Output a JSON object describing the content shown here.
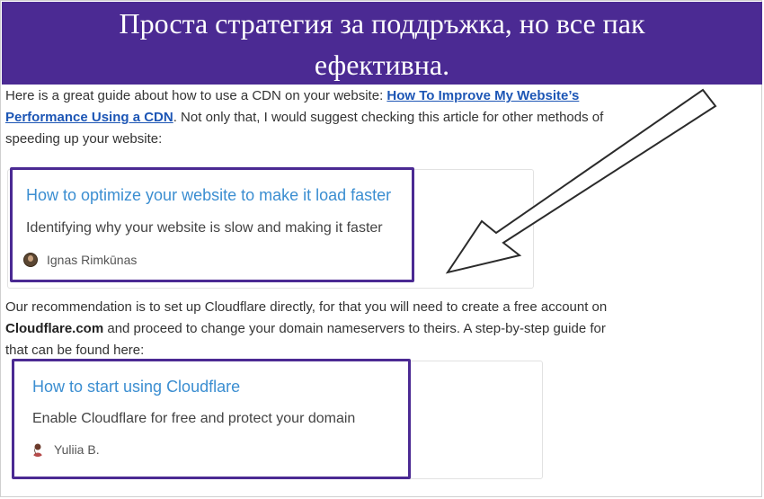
{
  "banner": {
    "line1": "Проста стратегия за поддръжка, но все пак",
    "line2": "ефективна."
  },
  "paragraph1": {
    "text_before": "Here is a great guide about how to use a CDN on your website: ",
    "link1": "How To Improve My Website’s",
    "link2": "Performance Using a CDN",
    "text_after1": ". Not only that, I would suggest checking this article for other methods of",
    "text_after2": "speeding up your website:"
  },
  "card1": {
    "title": "How to optimize your website to make it load faster",
    "description": "Identifying why your website is slow and making it faster",
    "author": "Ignas Rimkūnas"
  },
  "paragraph2": {
    "line1": "Our recommendation is to set up Cloudflare directly, for that you will need to create a free account on",
    "bold": "Cloudflare.com",
    "line2": " and proceed to change your domain nameservers to theirs. A step-by-step guide for",
    "line3": "that can be found here:"
  },
  "card2": {
    "title": "How to start using Cloudflare",
    "description": "Enable Cloudflare for free and protect your domain",
    "author": "Yuliia B."
  },
  "colors": {
    "banner_bg": "#4b2a93",
    "highlight": "#4b2a93",
    "link": "#1d56b5",
    "card_title": "#3b8ed1"
  }
}
